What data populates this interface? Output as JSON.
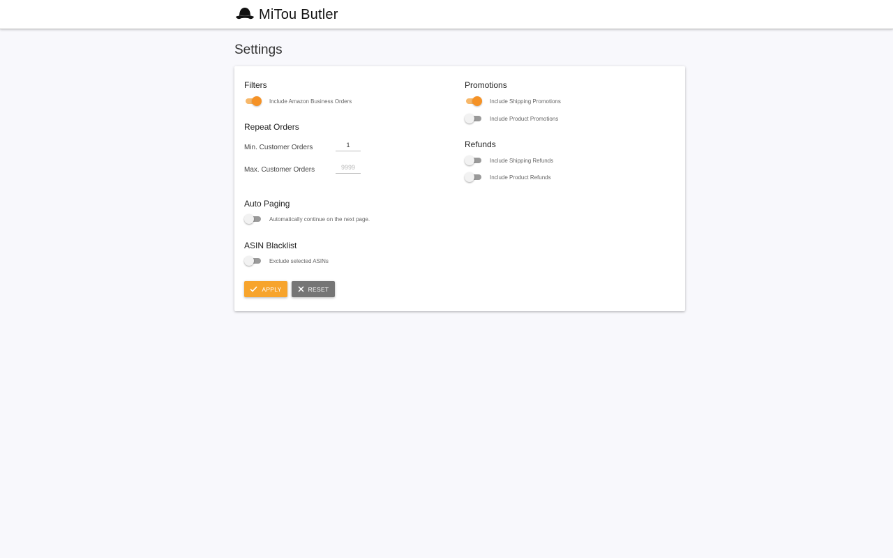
{
  "app": {
    "name": "MiTou Butler",
    "logo_icon": "bowler-hat-icon"
  },
  "page": {
    "title": "Settings"
  },
  "colors": {
    "accent": "#f59226",
    "accent_track": "#f7b86a",
    "apply_button": "#f7a42c",
    "reset_button": "#757575",
    "toggle_off_track": "#9a9a9a",
    "background": "#f8f8fc"
  },
  "filters": {
    "title": "Filters",
    "business_orders": {
      "label": "Include Amazon Business Orders",
      "enabled": true
    }
  },
  "repeat_orders": {
    "title": "Repeat Orders",
    "min_label": "Min. Customer Orders",
    "min_value": "1",
    "max_label": "Max. Customer Orders",
    "max_value": "",
    "max_placeholder": "9999"
  },
  "auto_paging": {
    "title": "Auto Paging",
    "label": "Automatically continue on the next page.",
    "enabled": false
  },
  "asin_blacklist": {
    "title": "ASIN Blacklist",
    "label": "Exclude selected ASINs",
    "enabled": false
  },
  "promotions": {
    "title": "Promotions",
    "shipping": {
      "label": "Include Shipping Promotions",
      "enabled": true
    },
    "product": {
      "label": "Include Product Promotions",
      "enabled": false
    }
  },
  "refunds": {
    "title": "Refunds",
    "shipping": {
      "label": "Include Shipping Refunds",
      "enabled": false
    },
    "product": {
      "label": "Include Product Refunds",
      "enabled": false
    }
  },
  "buttons": {
    "apply": {
      "label": "APPLY",
      "icon": "check-icon"
    },
    "reset": {
      "label": "RESET",
      "icon": "close-icon"
    }
  }
}
